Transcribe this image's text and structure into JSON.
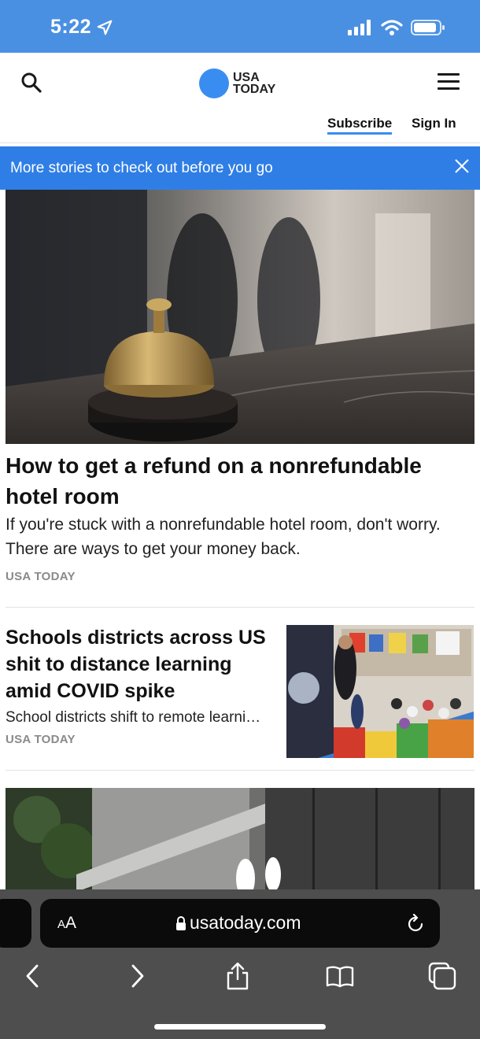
{
  "status_bar": {
    "time": "5:22"
  },
  "header": {
    "logo_line1": "USA",
    "logo_line2": "TODAY",
    "subscribe_label": "Subscribe",
    "signin_label": "Sign In"
  },
  "banner": {
    "text": "More stories to check out before you go"
  },
  "articles": [
    {
      "title": "How to get a refund on a nonrefundable hotel room",
      "summary": "If you're stuck with a nonrefundable hotel room, don't worry. There are ways to get your money back.",
      "source": "USA TODAY"
    },
    {
      "title": "Schools districts across US shit to distance learning amid COVID spike",
      "summary": "School districts shift to remote learni…",
      "source": "USA TODAY"
    }
  ],
  "safari": {
    "text_size_label_large": "A",
    "text_size_label_small": "A",
    "url": "usatoday.com"
  },
  "colors": {
    "status_bar": "#4a90e2",
    "brand_blue": "#3a8df0",
    "banner": "#2f7ee6",
    "toolbar": "#4e4e4e"
  }
}
